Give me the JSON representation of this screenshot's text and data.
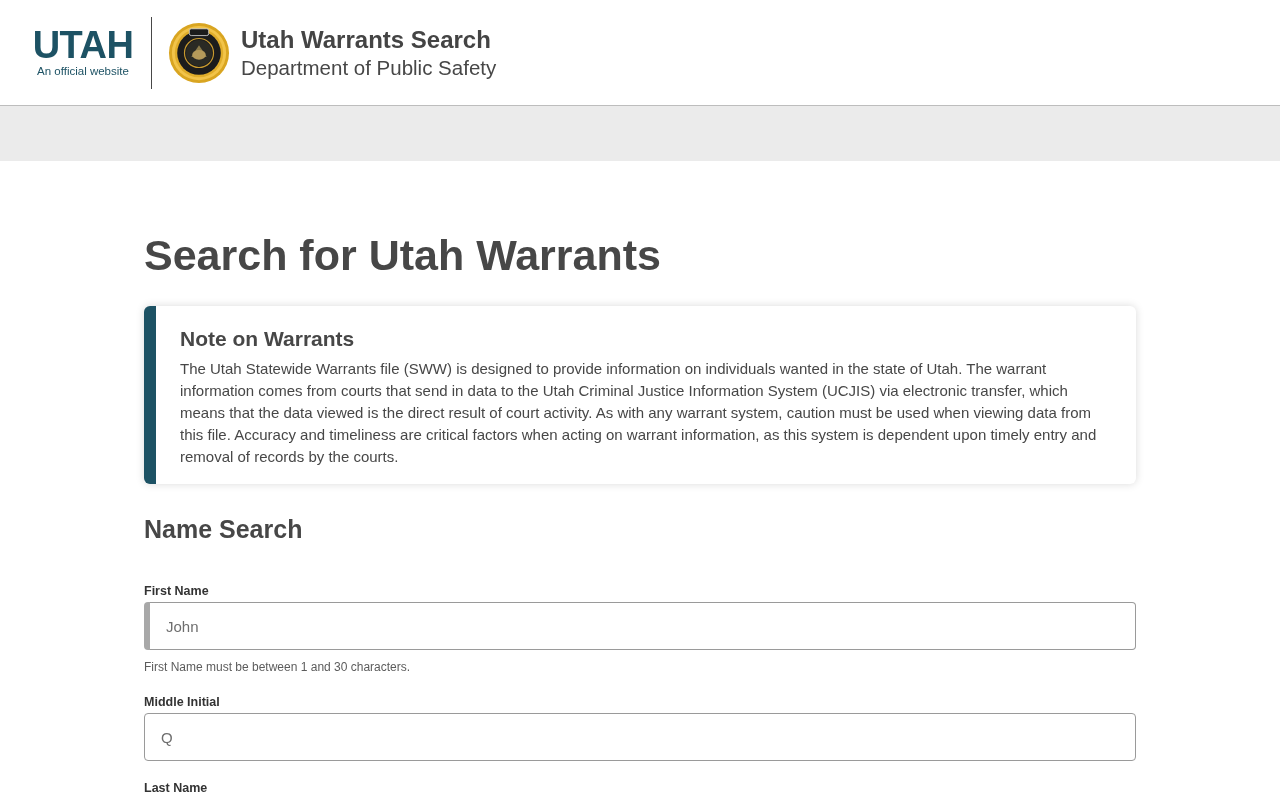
{
  "header": {
    "wordmark": "UTAH",
    "tagline": "An official website",
    "title": "Utah Warrants Search",
    "subtitle": "Department of Public Safety"
  },
  "page_title": "Search for Utah Warrants",
  "note": {
    "title": "Note on Warrants",
    "body": "The Utah Statewide Warrants file (SWW) is designed to provide information on individuals wanted in the state of Utah. The warrant information comes from courts that send in data to the Utah Criminal Justice Information System (UCJIS) via electronic transfer, which means that the data viewed is the direct result of court activity. As with any warrant system, caution must be used when viewing data from this file. Accuracy and timeliness are critical factors when acting on warrant information, as this system is dependent upon timely entry and removal of records by the courts."
  },
  "name_search": {
    "title": "Name Search",
    "fields": [
      {
        "label": "First Name",
        "placeholder": "John",
        "focused": true,
        "hint": "First Name must be between 1 and 30 characters."
      },
      {
        "label": "Middle Initial",
        "placeholder": "Q",
        "focused": false
      },
      {
        "label": "Last Name"
      }
    ]
  }
}
